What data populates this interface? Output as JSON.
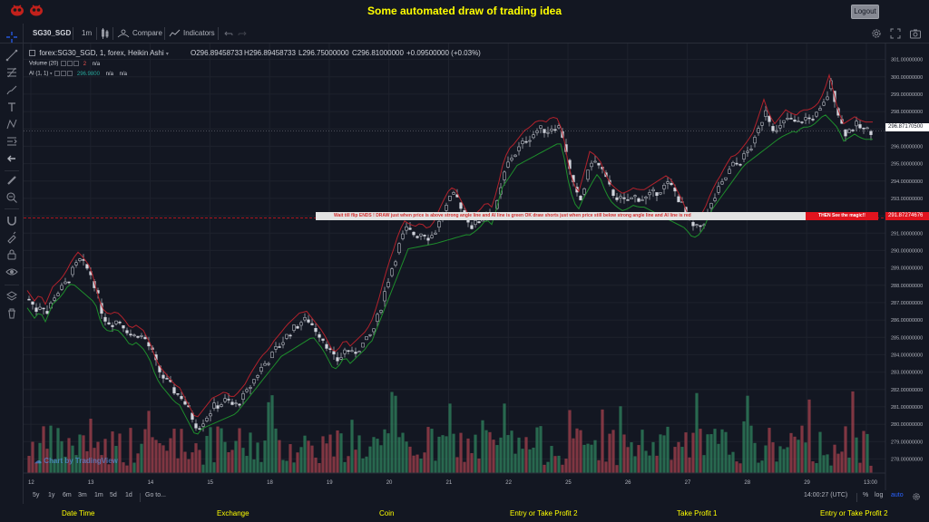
{
  "app": {
    "title": "Some automated draw of trading idea",
    "logout_label": "Logout"
  },
  "toolbar": {
    "symbol": "SG30_SGD",
    "interval": "1m",
    "compare_label": "Compare",
    "indicators_label": "Indicators"
  },
  "legend": {
    "title": "forex:SG30_SGD, 1, forex, Heikin Ashi",
    "open": "O296.89458733",
    "high": "H296.89458733",
    "low": "L296.75000000",
    "close": "C296.81000000",
    "change": "+0.09500000 (+0.03%)",
    "volume_label": "Volume (20)",
    "volume_value": "2",
    "volume_na": "n/a",
    "ai_label": "AI (1, 1)",
    "ai_value": "296.9800",
    "ai_na1": "n/a",
    "ai_na2": "n/a"
  },
  "banner": {
    "text": "Wait till flip ENDS  !   DRAW just when  price is above strong angle line and AI line is green          OK           draw shorts just when price still below strong angle line and AI line is red",
    "red_text": "THEN See the magic!!"
  },
  "price_axis": {
    "ticks": [
      "301.00000000",
      "300.00000000",
      "299.00000000",
      "298.00000000",
      "297.00000000",
      "296.00000000",
      "295.00000000",
      "294.00000000",
      "293.00000000",
      "292.00000000",
      "291.00000000",
      "290.00000000",
      "289.00000000",
      "288.00000000",
      "287.00000000",
      "286.00000000",
      "285.00000000",
      "284.00000000",
      "283.00000000",
      "282.00000000",
      "281.00000000",
      "280.00000000",
      "279.00000000",
      "278.00000000"
    ],
    "current_price": "296.87170500",
    "line_price": "291.87274676"
  },
  "time_axis": {
    "labels": [
      "12",
      "13",
      "14",
      "15",
      "18",
      "19",
      "20",
      "21",
      "22",
      "25",
      "26",
      "27",
      "28",
      "29",
      "13:00"
    ]
  },
  "bottombar": {
    "ranges": [
      "5y",
      "1y",
      "6m",
      "3m",
      "1m",
      "5d",
      "1d"
    ],
    "goto_label": "Go to...",
    "clock": "14:00:27 (UTC)",
    "percent": "%",
    "log": "log",
    "auto": "auto"
  },
  "watermark": "Chart by TradingView",
  "footer": {
    "labels": [
      "Date Time",
      "Exchange",
      "Coin",
      "Entry or Take Profit 2",
      "Take Profit 1",
      "Entry or Take Profit 2"
    ]
  },
  "colors": {
    "up": "#26a69a",
    "down": "#ef5350",
    "vol_up": "#2e7d5b",
    "vol_down": "#9c3f4b",
    "ai_green": "#1e8e2c",
    "ai_red": "#b2222c",
    "accent": "#2962ff"
  },
  "chart_data": {
    "type": "candlestick",
    "ylim": [
      277.5,
      301.5
    ],
    "price_path": [
      [
        0,
        287.2
      ],
      [
        8,
        286.6
      ],
      [
        14,
        287.0
      ],
      [
        20,
        286.4
      ],
      [
        28,
        287.4
      ],
      [
        36,
        287.8
      ],
      [
        42,
        288.2
      ],
      [
        50,
        289.0
      ],
      [
        56,
        289.4
      ],
      [
        62,
        289.1
      ],
      [
        70,
        288.5
      ],
      [
        76,
        287.3
      ],
      [
        82,
        286.2
      ],
      [
        90,
        285.8
      ],
      [
        98,
        286.0
      ],
      [
        106,
        285.6
      ],
      [
        114,
        285.0
      ],
      [
        120,
        285.2
      ],
      [
        128,
        284.9
      ],
      [
        136,
        284.1
      ],
      [
        142,
        283.2
      ],
      [
        148,
        282.7
      ],
      [
        156,
        282.2
      ],
      [
        162,
        281.8
      ],
      [
        168,
        281.6
      ],
      [
        174,
        281.0
      ],
      [
        180,
        280.4
      ],
      [
        186,
        279.8
      ],
      [
        192,
        280.2
      ],
      [
        198,
        280.6
      ],
      [
        204,
        281.0
      ],
      [
        212,
        281.2
      ],
      [
        218,
        281.4
      ],
      [
        226,
        281.0
      ],
      [
        232,
        281.3
      ],
      [
        240,
        281.8
      ],
      [
        246,
        282.4
      ],
      [
        252,
        282.9
      ],
      [
        258,
        283.4
      ],
      [
        266,
        283.8
      ],
      [
        272,
        284.3
      ],
      [
        280,
        284.8
      ],
      [
        286,
        285.2
      ],
      [
        294,
        285.6
      ],
      [
        300,
        285.9
      ],
      [
        308,
        286.0
      ],
      [
        314,
        285.6
      ],
      [
        320,
        285.2
      ],
      [
        326,
        284.8
      ],
      [
        332,
        284.2
      ],
      [
        338,
        283.6
      ],
      [
        344,
        283.9
      ],
      [
        350,
        284.4
      ],
      [
        356,
        284.0
      ],
      [
        362,
        284.3
      ],
      [
        368,
        284.6
      ],
      [
        374,
        284.9
      ],
      [
        380,
        285.5
      ],
      [
        386,
        286.4
      ],
      [
        392,
        287.6
      ],
      [
        398,
        288.7
      ],
      [
        404,
        289.6
      ],
      [
        410,
        290.6
      ],
      [
        416,
        291.2
      ],
      [
        422,
        291.0
      ],
      [
        428,
        290.9
      ],
      [
        434,
        291.1
      ],
      [
        440,
        290.8
      ],
      [
        446,
        290.9
      ],
      [
        452,
        291.6
      ],
      [
        458,
        292.3
      ],
      [
        464,
        292.9
      ],
      [
        470,
        293.2
      ],
      [
        476,
        292.6
      ],
      [
        482,
        292.0
      ],
      [
        488,
        291.4
      ],
      [
        494,
        291.6
      ],
      [
        500,
        291.9
      ],
      [
        506,
        292.3
      ],
      [
        512,
        292.0
      ],
      [
        518,
        293.0
      ],
      [
        524,
        294.4
      ],
      [
        530,
        295.3
      ],
      [
        536,
        295.6
      ],
      [
        542,
        296.0
      ],
      [
        548,
        296.4
      ],
      [
        554,
        296.6
      ],
      [
        560,
        296.9
      ],
      [
        566,
        297.0
      ],
      [
        572,
        296.9
      ],
      [
        578,
        297.2
      ],
      [
        584,
        297.1
      ],
      [
        590,
        296.4
      ],
      [
        596,
        294.6
      ],
      [
        602,
        293.3
      ],
      [
        608,
        292.9
      ],
      [
        614,
        294.0
      ],
      [
        620,
        295.2
      ],
      [
        626,
        295.0
      ],
      [
        632,
        294.6
      ],
      [
        638,
        293.8
      ],
      [
        644,
        293.3
      ],
      [
        650,
        293.0
      ],
      [
        656,
        292.8
      ],
      [
        662,
        292.9
      ],
      [
        668,
        293.1
      ],
      [
        674,
        293.0
      ],
      [
        680,
        293.0
      ],
      [
        686,
        293.2
      ],
      [
        692,
        293.4
      ],
      [
        698,
        293.6
      ],
      [
        704,
        293.8
      ],
      [
        710,
        293.6
      ],
      [
        716,
        293.0
      ],
      [
        722,
        292.4
      ],
      [
        728,
        291.6
      ],
      [
        734,
        291.2
      ],
      [
        740,
        291.4
      ],
      [
        746,
        291.8
      ],
      [
        752,
        292.6
      ],
      [
        758,
        293.3
      ],
      [
        764,
        293.8
      ],
      [
        770,
        294.4
      ],
      [
        776,
        294.9
      ],
      [
        782,
        295.0
      ],
      [
        788,
        295.4
      ],
      [
        794,
        295.8
      ],
      [
        800,
        296.3
      ],
      [
        806,
        297.2
      ],
      [
        812,
        298.2
      ],
      [
        818,
        297.3
      ],
      [
        824,
        296.8
      ],
      [
        830,
        297.2
      ],
      [
        836,
        297.6
      ],
      [
        842,
        297.4
      ],
      [
        848,
        297.3
      ],
      [
        854,
        297.6
      ],
      [
        860,
        297.6
      ],
      [
        866,
        297.7
      ],
      [
        872,
        298.0
      ],
      [
        878,
        298.6
      ],
      [
        884,
        299.6
      ],
      [
        888,
        298.8
      ],
      [
        894,
        297.5
      ],
      [
        900,
        296.8
      ],
      [
        906,
        297.0
      ],
      [
        912,
        297.2
      ],
      [
        918,
        297.0
      ],
      [
        924,
        296.9
      ],
      [
        932,
        296.9
      ]
    ],
    "ai_line_path": [
      [
        0,
        286.8
      ],
      [
        50,
        288.1
      ],
      [
        90,
        286.3
      ],
      [
        140,
        283.7
      ],
      [
        186,
        279.6
      ],
      [
        230,
        280.6
      ],
      [
        280,
        283.9
      ],
      [
        320,
        285.2
      ],
      [
        340,
        283.5
      ],
      [
        380,
        284.8
      ],
      [
        420,
        290.1
      ],
      [
        450,
        290.4
      ],
      [
        490,
        291.0
      ],
      [
        540,
        294.9
      ],
      [
        590,
        296.3
      ],
      [
        610,
        292.7
      ],
      [
        630,
        294.6
      ],
      [
        680,
        292.5
      ],
      [
        736,
        291.0
      ],
      [
        790,
        294.9
      ],
      [
        830,
        296.5
      ],
      [
        880,
        297.8
      ],
      [
        900,
        296.7
      ],
      [
        932,
        296.7
      ]
    ]
  }
}
